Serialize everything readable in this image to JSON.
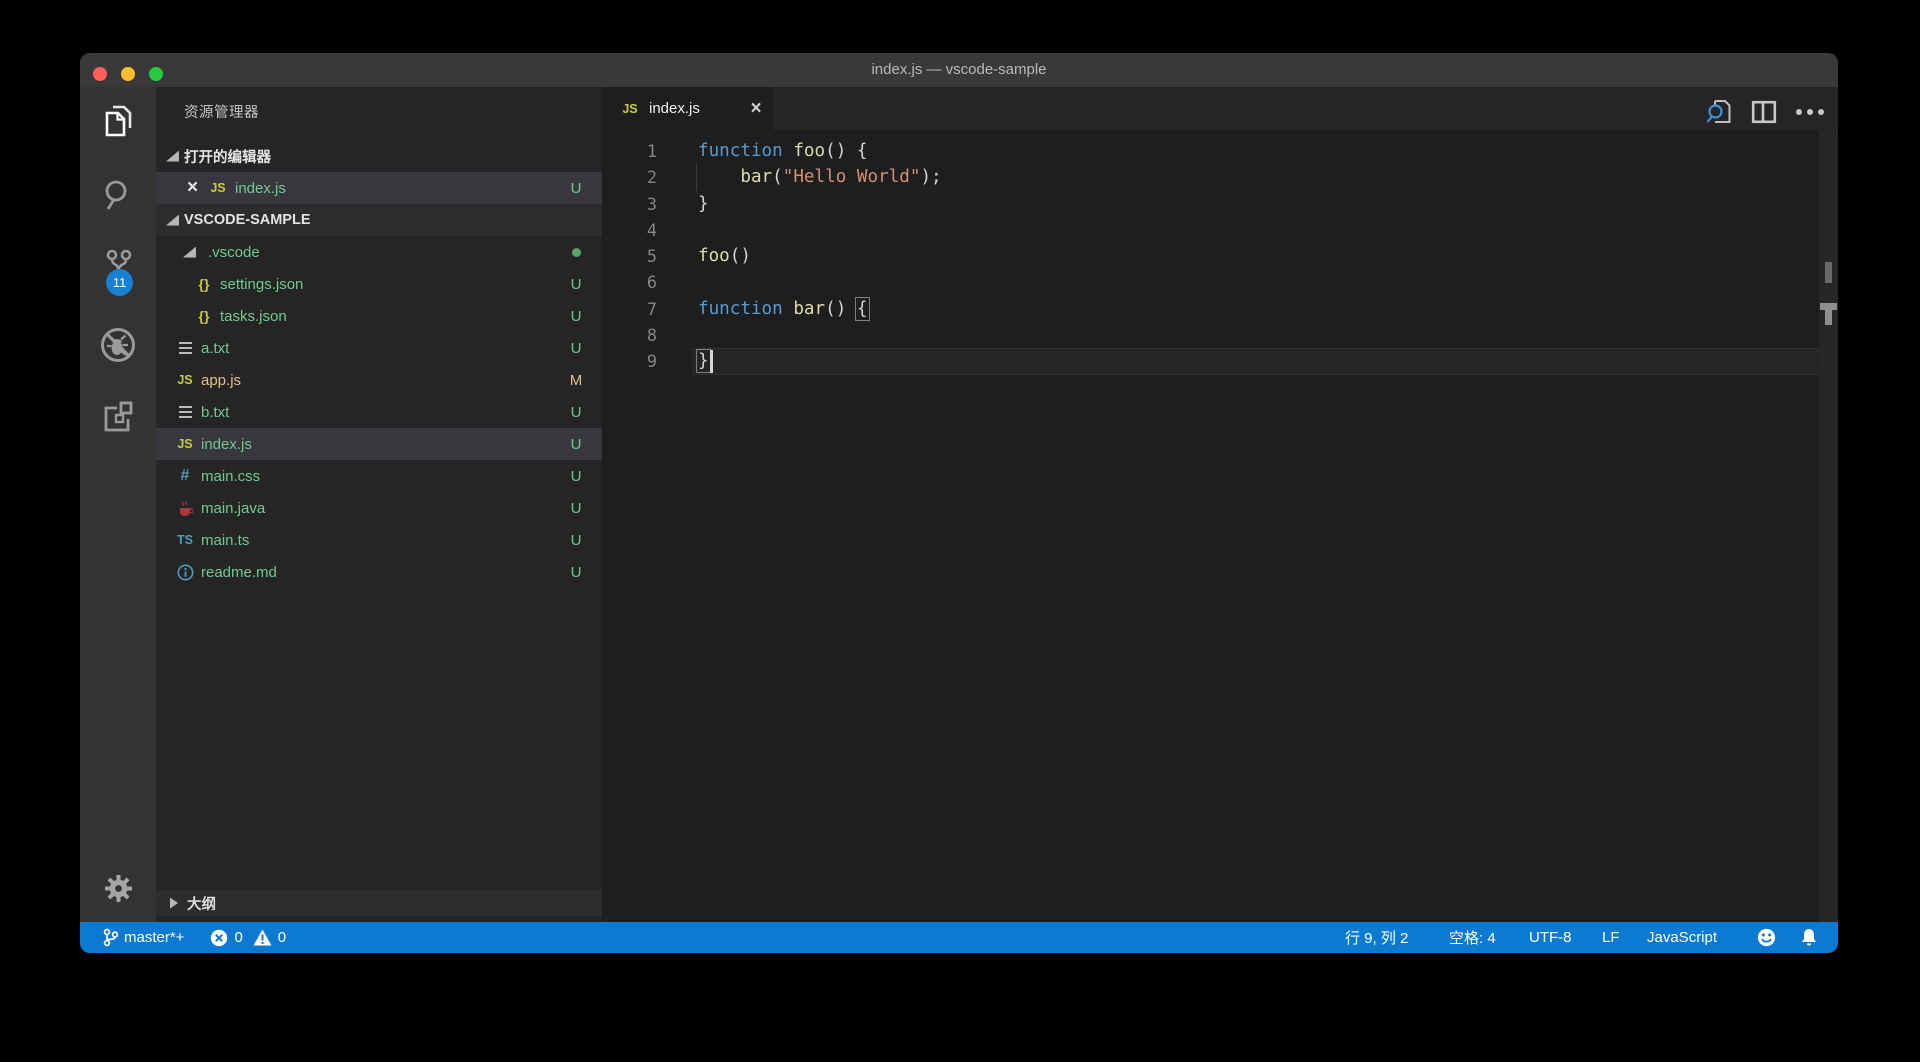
{
  "window": {
    "title": "index.js — vscode-sample"
  },
  "activity_bar": {
    "items": [
      {
        "icon": "files-icon",
        "active": true
      },
      {
        "icon": "search-icon"
      },
      {
        "icon": "source-control-icon",
        "badge": "11"
      },
      {
        "icon": "debug-disabled-icon"
      },
      {
        "icon": "extensions-icon"
      }
    ],
    "bottom_items": [
      {
        "icon": "gear-icon"
      }
    ]
  },
  "sidebar": {
    "title": "资源管理器",
    "open_editors_label": "打开的编辑器",
    "folder_label": "VSCODE-SAMPLE",
    "outline_label": "大纲",
    "open_editors": [
      {
        "name": "index.js",
        "icon": "js",
        "git": "U"
      }
    ],
    "tree": [
      {
        "name": ".vscode",
        "type": "folder",
        "level": 1,
        "dot": true
      },
      {
        "name": "settings.json",
        "icon": "json",
        "level": 2,
        "git": "U"
      },
      {
        "name": "tasks.json",
        "icon": "json",
        "level": 2,
        "git": "U"
      },
      {
        "name": "a.txt",
        "icon": "txt",
        "level": 1,
        "git": "U"
      },
      {
        "name": "app.js",
        "icon": "js",
        "level": 1,
        "git": "M",
        "modified": true
      },
      {
        "name": "b.txt",
        "icon": "txt",
        "level": 1,
        "git": "U"
      },
      {
        "name": "index.js",
        "icon": "js",
        "level": 1,
        "git": "U",
        "selected": true
      },
      {
        "name": "main.css",
        "icon": "css",
        "level": 1,
        "git": "U"
      },
      {
        "name": "main.java",
        "icon": "java",
        "level": 1,
        "git": "U"
      },
      {
        "name": "main.ts",
        "icon": "ts",
        "level": 1,
        "git": "U"
      },
      {
        "name": "readme.md",
        "icon": "md",
        "level": 1,
        "git": "U"
      }
    ]
  },
  "editor": {
    "tab": {
      "name": "index.js",
      "icon": "js"
    },
    "actions": [
      "search-editor-icon",
      "split-editor-icon",
      "more-actions-icon"
    ],
    "lines": [
      {
        "n": 1,
        "tokens": [
          {
            "t": "function",
            "c": "kw"
          },
          {
            "t": " ",
            "c": "pl"
          },
          {
            "t": "foo",
            "c": "fn"
          },
          {
            "t": "() {",
            "c": "pl"
          }
        ]
      },
      {
        "n": 2,
        "tokens": [
          {
            "t": "    ",
            "c": "pl"
          },
          {
            "t": "bar",
            "c": "fn"
          },
          {
            "t": "(",
            "c": "pl"
          },
          {
            "t": "\"Hello World\"",
            "c": "str"
          },
          {
            "t": ");",
            "c": "pl"
          }
        ]
      },
      {
        "n": 3,
        "tokens": [
          {
            "t": "}",
            "c": "pl"
          }
        ]
      },
      {
        "n": 4,
        "tokens": []
      },
      {
        "n": 5,
        "tokens": [
          {
            "t": "foo",
            "c": "fn"
          },
          {
            "t": "()",
            "c": "pl"
          }
        ]
      },
      {
        "n": 6,
        "tokens": []
      },
      {
        "n": 7,
        "tokens": [
          {
            "t": "function",
            "c": "kw"
          },
          {
            "t": " ",
            "c": "pl"
          },
          {
            "t": "bar",
            "c": "fn"
          },
          {
            "t": "() ",
            "c": "pl"
          },
          {
            "t": "{",
            "c": "pl bm"
          }
        ]
      },
      {
        "n": 8,
        "tokens": []
      },
      {
        "n": 9,
        "tokens": [
          {
            "t": "}",
            "c": "pl bm"
          }
        ]
      }
    ],
    "cursor": {
      "line": 9,
      "col": 2
    }
  },
  "status_bar": {
    "left": [
      {
        "icon": "git-branch-icon",
        "label": "master*+"
      },
      {
        "icon": "error-icon",
        "label": "0"
      },
      {
        "icon": "warning-icon",
        "label": "0"
      }
    ],
    "right": [
      {
        "label": "行 9, 列 2"
      },
      {
        "label": "空格: 4"
      },
      {
        "label": "UTF-8"
      },
      {
        "label": "LF"
      },
      {
        "label": "JavaScript"
      },
      {
        "icon": "smiley-icon"
      },
      {
        "icon": "bell-icon"
      }
    ]
  }
}
